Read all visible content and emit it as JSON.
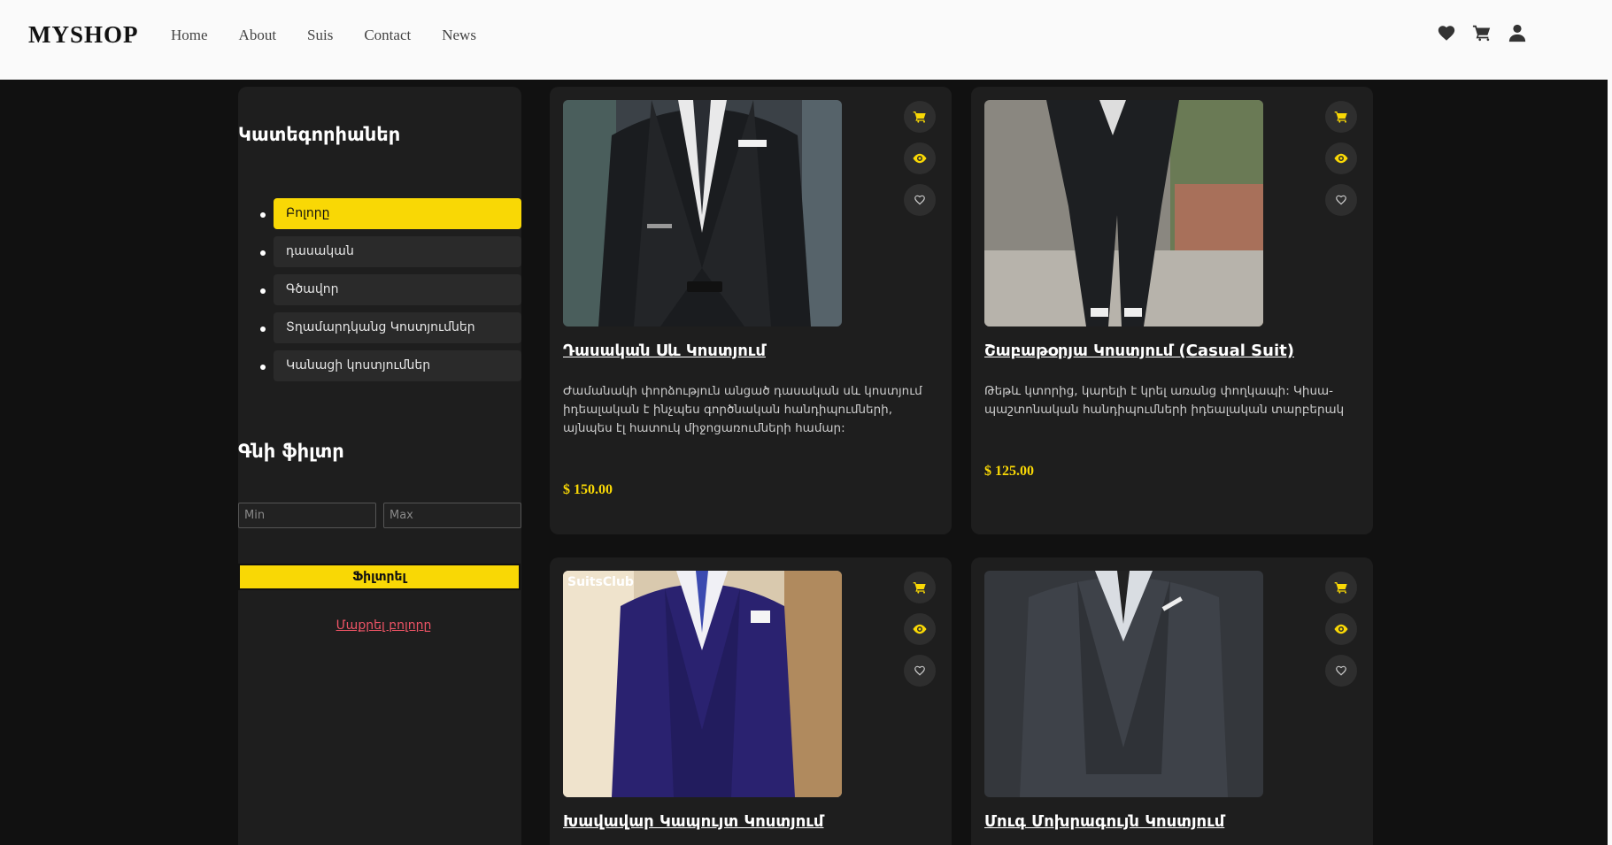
{
  "header": {
    "logo": "MYSHOP",
    "nav": [
      "Home",
      "About",
      "Suis",
      "Contact",
      "News"
    ],
    "icons": [
      "heart-icon",
      "cart-icon",
      "user-icon"
    ]
  },
  "sidebar": {
    "categories_title": "Կատեգորիաներ",
    "categories": [
      "Բոլորը",
      "դասական",
      "Գծավոր",
      "Տղամարդկանց Կոստյումներ",
      "Կանացի կոստյումներ"
    ],
    "active_category": "Բոլորը",
    "price_title": "Գնի ֆիլտր",
    "min_placeholder": "Min",
    "max_placeholder": "Max",
    "filter_label": "Ֆիլտրել",
    "clear_label": "Մաքրել բոլորը"
  },
  "products": [
    {
      "title": "Դասական Սև Կոստյում",
      "description": "Ժամանակի փորձություն անցած դասական սև կոստյում իդեալական է ինչպես գործնական հանդիպումների, այնպես էլ հատուկ միջոցառումների համար:",
      "price": "$ 150.00"
    },
    {
      "title": "Շաբաթօրյա Կոստյում (Casual Suit)",
      "description": "Թեթև կտորից, կարելի է կրել առանց փողկապի: Կիսա-պաշտոնական հանդիպումների իդեալական տարբերակ",
      "price": "$ 125.00"
    },
    {
      "title": "Խավավար Կապույտ Կոստյում",
      "description": "",
      "price": "",
      "brand": "SuitsClub"
    },
    {
      "title": "Մուգ Մոխրագույն Կոստյում",
      "description": "",
      "price": ""
    }
  ],
  "colors": {
    "accent": "#f9d805",
    "background": "#111111",
    "card": "#1e1e1e",
    "link_red": "#ef5466"
  }
}
